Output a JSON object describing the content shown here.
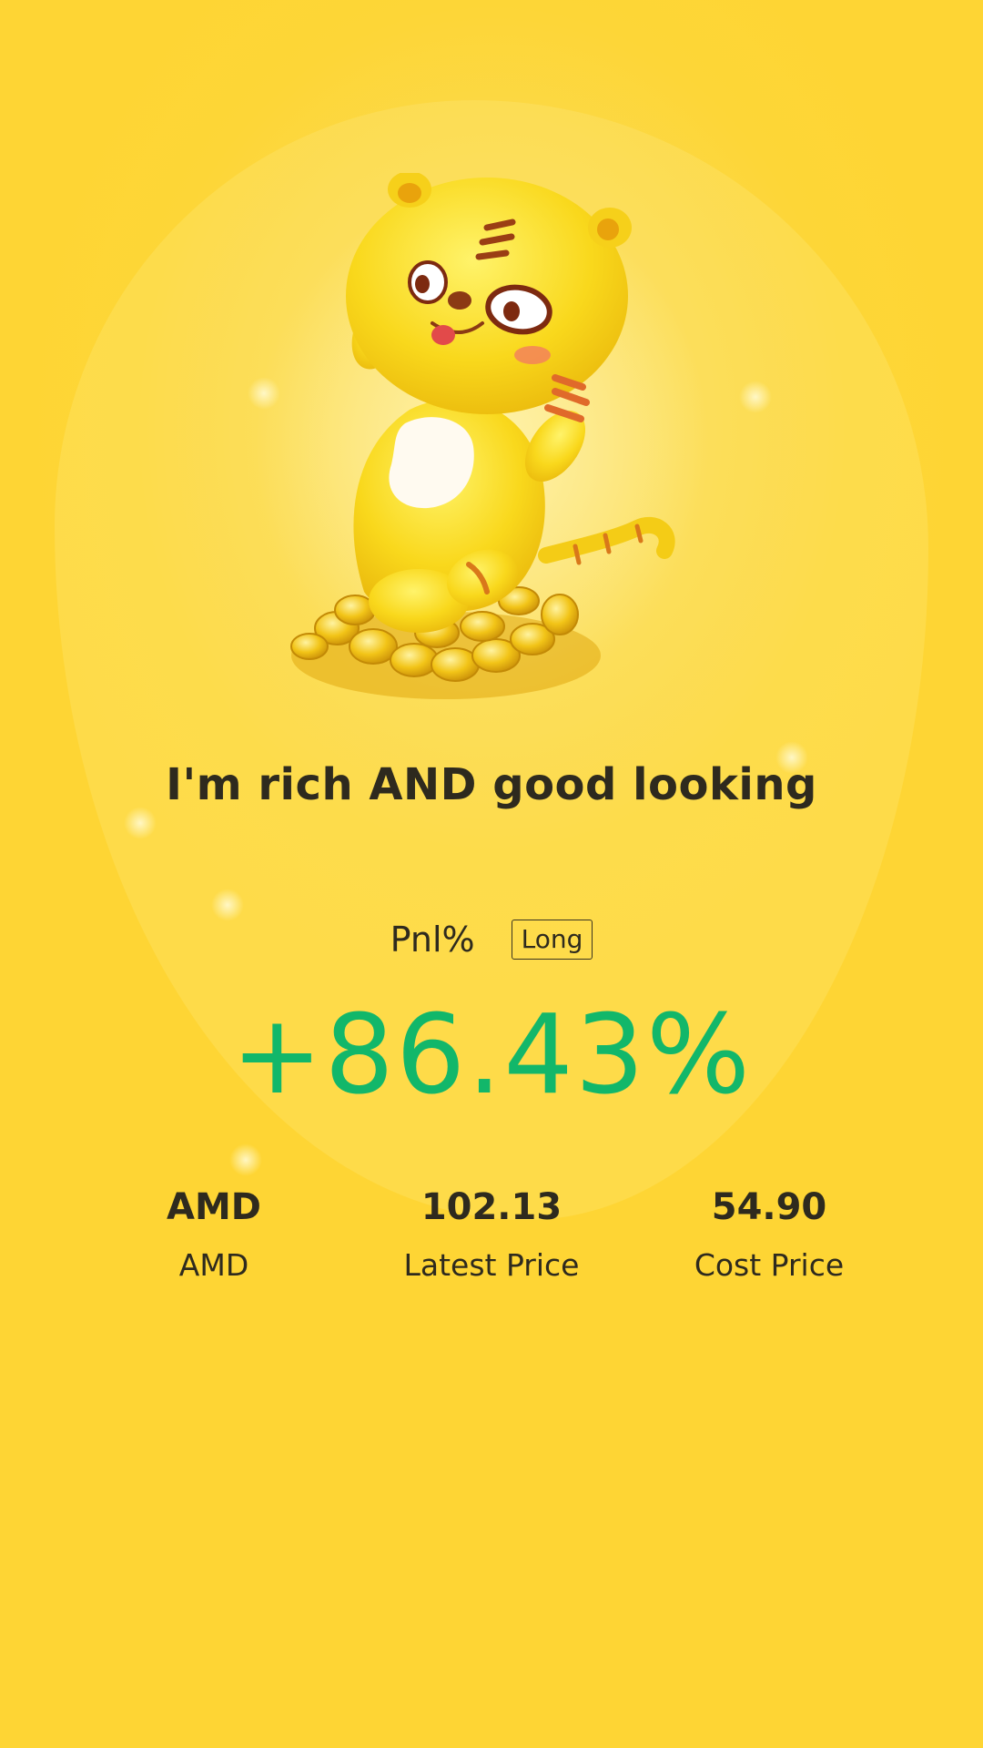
{
  "headline": "I'm rich AND good looking",
  "pnl": {
    "label": "Pnl%",
    "direction": "Long",
    "value": "+86.43%",
    "value_color": "#12b76a"
  },
  "stats": [
    {
      "value": "AMD",
      "label": "AMD"
    },
    {
      "value": "102.13",
      "label": "Latest Price"
    },
    {
      "value": "54.90",
      "label": "Cost Price"
    }
  ],
  "mascot": {
    "icon": "tiger-mascot-icon"
  },
  "colors": {
    "background": "#fdd637",
    "text": "#2e2a1e",
    "positive": "#12b76a"
  }
}
